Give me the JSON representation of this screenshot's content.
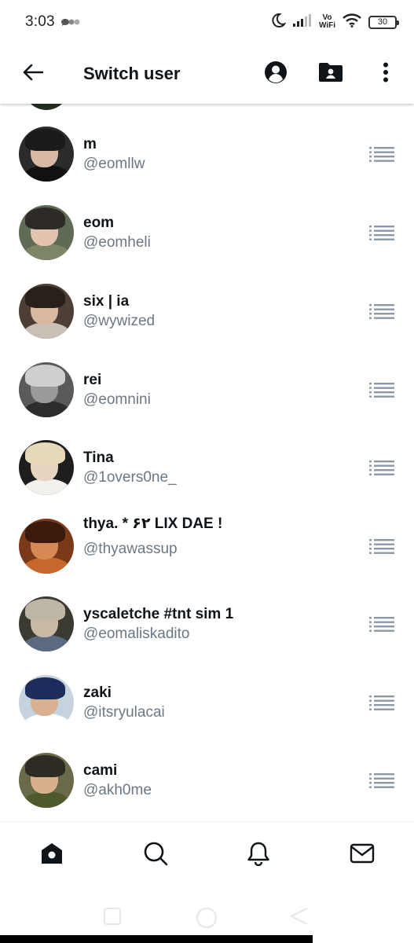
{
  "status_bar": {
    "time": "3:03",
    "vowifi_top": "Vo",
    "vowifi_bottom": "WiFi",
    "battery": "30"
  },
  "header": {
    "title": "Switch user"
  },
  "accounts": [
    {
      "name": "m",
      "handle": "@eomllw",
      "colors": {
        "bg": "#2b2b2b",
        "hair": "#1a1a1a",
        "face": "#d8b9a6",
        "body": "#111111"
      }
    },
    {
      "name": "eom",
      "handle": "@eomheli",
      "colors": {
        "bg": "#5f6b55",
        "hair": "#2e2a26",
        "face": "#e2c4b0",
        "body": "#7c8667"
      }
    },
    {
      "name": "six | ia",
      "handle": "@wywized",
      "colors": {
        "bg": "#4d3f35",
        "hair": "#2a201a",
        "face": "#d9b8a0",
        "body": "#c9c0b5"
      }
    },
    {
      "name": "rei",
      "handle": "@eomnini",
      "colors": {
        "bg": "#5a5a5a",
        "hair": "#cfcfcf",
        "face": "#9a9a9a",
        "body": "#2d2d2d"
      }
    },
    {
      "name": "Tina",
      "handle": "@1overs0ne_",
      "colors": {
        "bg": "#1e1e1e",
        "hair": "#e7d9b8",
        "face": "#e8d2c0",
        "body": "#f2f0ec"
      }
    },
    {
      "name": "thya. * ۶۲ LIX DAE !",
      "handle": "@thyawassup",
      "colors": {
        "bg": "#7a3a1a",
        "hair": "#3a1a0a",
        "face": "#d58a55",
        "body": "#c6682c"
      }
    },
    {
      "name": "yscaletche #tnt sim 1",
      "handle": "@eomaliskadito",
      "colors": {
        "bg": "#3b3a33",
        "hair": "#bfb7a5",
        "face": "#c8b8a4",
        "body": "#5a6b80"
      }
    },
    {
      "name": "zaki",
      "handle": "@itsryulacai",
      "colors": {
        "bg": "#c6d3df",
        "hair": "#1d2c5a",
        "face": "#d9b090",
        "body": "#ffffff"
      }
    },
    {
      "name": "cami",
      "handle": "@akh0me",
      "colors": {
        "bg": "#6a6a4a",
        "hair": "#2d2b22",
        "face": "#d8b08c",
        "body": "#4e5a2c"
      }
    }
  ],
  "icons": {
    "back": "arrow-left-icon",
    "profile": "account-circle-icon",
    "folder": "folder-account-icon",
    "more": "more-vertical-icon",
    "reorder": "reorder-handle-icon",
    "home": "home-icon",
    "search": "search-icon",
    "notifications": "bell-icon",
    "messages": "mail-icon"
  }
}
